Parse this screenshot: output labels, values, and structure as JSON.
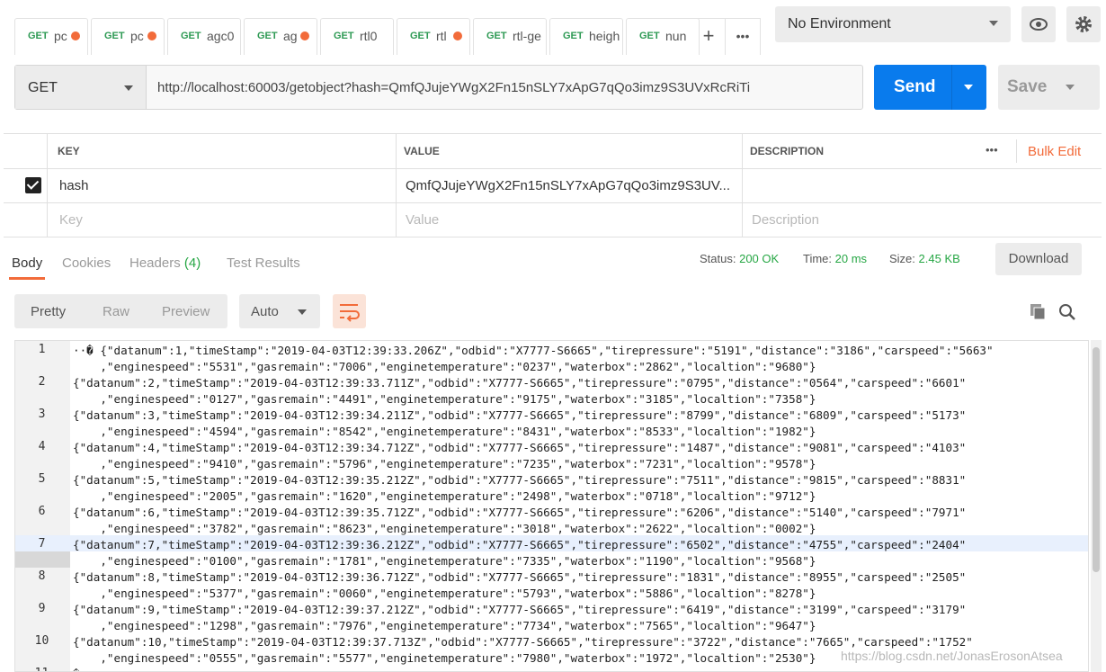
{
  "tabs": [
    {
      "method": "GET",
      "name": "pc",
      "dot": true
    },
    {
      "method": "GET",
      "name": "pc",
      "dot": true
    },
    {
      "method": "GET",
      "name": "agc0",
      "dot": false
    },
    {
      "method": "GET",
      "name": "ag",
      "dot": true
    },
    {
      "method": "GET",
      "name": "rtl0",
      "dot": false
    },
    {
      "method": "GET",
      "name": "rtl",
      "dot": true
    },
    {
      "method": "GET",
      "name": "rtl-ge",
      "dot": false
    },
    {
      "method": "GET",
      "name": "heigh",
      "dot": false
    },
    {
      "method": "GET",
      "name": "nun",
      "dot": false
    }
  ],
  "tabbar": {
    "add_icon": "+",
    "more_icon": "•••"
  },
  "environment": {
    "selected": "No Environment",
    "eye_icon": "eye-icon",
    "gear_icon": "gear-icon"
  },
  "request": {
    "method": "GET",
    "url": "http://localhost:60003/getobject?hash=QmfQJujeYWgX2Fn15nSLY7xApG7qQo3imz9S3UVxRcRiTi",
    "send_label": "Send",
    "save_label": "Save"
  },
  "params": {
    "headers": {
      "key": "KEY",
      "value": "VALUE",
      "description": "DESCRIPTION",
      "more": "•••",
      "bulk_edit": "Bulk Edit"
    },
    "row": {
      "key": "hash",
      "value": "QmfQJujeYWgX2Fn15nSLY7xApG7qQo3imz9S3UV...",
      "checked": true
    },
    "placeholder": {
      "key": "Key",
      "value": "Value",
      "description": "Description"
    }
  },
  "response_tabs": {
    "body": "Body",
    "cookies": "Cookies",
    "headers": "Headers",
    "headers_count": "(4)",
    "tests": "Test Results"
  },
  "status": {
    "status_label": "Status:",
    "status_value": "200 OK",
    "time_label": "Time:",
    "time_value": "20 ms",
    "size_label": "Size:",
    "size_value": "2.45 KB",
    "download": "Download"
  },
  "viewer": {
    "pretty": "Pretty",
    "raw": "Raw",
    "preview": "Preview",
    "format": "Auto"
  },
  "code_lines": [
    {
      "n": "1",
      "a": "··� {\"datanum\":1,\"timeStamp\":\"2019-04-03T12:39:33.206Z\",\"odbid\":\"X7777-S6665\",\"tirepressure\":\"5191\",\"distance\":\"3186\",\"carspeed\":\"5663\"",
      "b": "    ,\"enginespeed\":\"5531\",\"gasremain\":\"7006\",\"enginetemperature\":\"0237\",\"waterbox\":\"2862\",\"localtion\":\"9680\"}"
    },
    {
      "n": "2",
      "a": "{\"datanum\":2,\"timeStamp\":\"2019-04-03T12:39:33.711Z\",\"odbid\":\"X7777-S6665\",\"tirepressure\":\"0795\",\"distance\":\"0564\",\"carspeed\":\"6601\"",
      "b": "    ,\"enginespeed\":\"0127\",\"gasremain\":\"4491\",\"enginetemperature\":\"9175\",\"waterbox\":\"3185\",\"localtion\":\"7358\"}"
    },
    {
      "n": "3",
      "a": "{\"datanum\":3,\"timeStamp\":\"2019-04-03T12:39:34.211Z\",\"odbid\":\"X7777-S6665\",\"tirepressure\":\"8799\",\"distance\":\"6809\",\"carspeed\":\"5173\"",
      "b": "    ,\"enginespeed\":\"4594\",\"gasremain\":\"8542\",\"enginetemperature\":\"8431\",\"waterbox\":\"8533\",\"localtion\":\"1982\"}"
    },
    {
      "n": "4",
      "a": "{\"datanum\":4,\"timeStamp\":\"2019-04-03T12:39:34.712Z\",\"odbid\":\"X7777-S6665\",\"tirepressure\":\"1487\",\"distance\":\"9081\",\"carspeed\":\"4103\"",
      "b": "    ,\"enginespeed\":\"9410\",\"gasremain\":\"5796\",\"enginetemperature\":\"7235\",\"waterbox\":\"7231\",\"localtion\":\"9578\"}"
    },
    {
      "n": "5",
      "a": "{\"datanum\":5,\"timeStamp\":\"2019-04-03T12:39:35.212Z\",\"odbid\":\"X7777-S6665\",\"tirepressure\":\"7511\",\"distance\":\"9815\",\"carspeed\":\"8831\"",
      "b": "    ,\"enginespeed\":\"2005\",\"gasremain\":\"1620\",\"enginetemperature\":\"2498\",\"waterbox\":\"0718\",\"localtion\":\"9712\"}"
    },
    {
      "n": "6",
      "a": "{\"datanum\":6,\"timeStamp\":\"2019-04-03T12:39:35.712Z\",\"odbid\":\"X7777-S6665\",\"tirepressure\":\"6206\",\"distance\":\"5140\",\"carspeed\":\"7971\"",
      "b": "    ,\"enginespeed\":\"3782\",\"gasremain\":\"8623\",\"enginetemperature\":\"3018\",\"waterbox\":\"2622\",\"localtion\":\"0002\"}"
    },
    {
      "n": "7",
      "a": "{\"datanum\":7,\"timeStamp\":\"2019-04-03T12:39:36.212Z\",\"odbid\":\"X7777-S6665\",\"tirepressure\":\"6502\",\"distance\":\"4755\",\"carspeed\":\"2404\"",
      "b": "    ,\"enginespeed\":\"0100\",\"gasremain\":\"1781\",\"enginetemperature\":\"7335\",\"waterbox\":\"1190\",\"localtion\":\"9568\"}"
    },
    {
      "n": "8",
      "a": "{\"datanum\":8,\"timeStamp\":\"2019-04-03T12:39:36.712Z\",\"odbid\":\"X7777-S6665\",\"tirepressure\":\"1831\",\"distance\":\"8955\",\"carspeed\":\"2505\"",
      "b": "    ,\"enginespeed\":\"5377\",\"gasremain\":\"0060\",\"enginetemperature\":\"5793\",\"waterbox\":\"5886\",\"localtion\":\"8278\"}"
    },
    {
      "n": "9",
      "a": "{\"datanum\":9,\"timeStamp\":\"2019-04-03T12:39:37.212Z\",\"odbid\":\"X7777-S6665\",\"tirepressure\":\"6419\",\"distance\":\"3199\",\"carspeed\":\"3179\"",
      "b": "    ,\"enginespeed\":\"1298\",\"gasremain\":\"7976\",\"enginetemperature\":\"7734\",\"waterbox\":\"7565\",\"localtion\":\"9647\"}"
    },
    {
      "n": "10",
      "a": "{\"datanum\":10,\"timeStamp\":\"2019-04-03T12:39:37.713Z\",\"odbid\":\"X7777-S6665\",\"tirepressure\":\"3722\",\"distance\":\"7665\",\"carspeed\":\"1752\"",
      "b": "    ,\"enginespeed\":\"0555\",\"gasremain\":\"5577\",\"enginetemperature\":\"7980\",\"waterbox\":\"1972\",\"localtion\":\"2530\"}"
    },
    {
      "n": "11",
      "a": "�",
      "b": ""
    }
  ],
  "watermark": "https://blog.csdn.net/JonasErosonAtsea",
  "colors": {
    "accent": "#097bed",
    "method_get": "#2e9a54",
    "dirty_dot": "#f26b3a",
    "success": "#27a745",
    "bulk_edit": "#f26b3a"
  }
}
